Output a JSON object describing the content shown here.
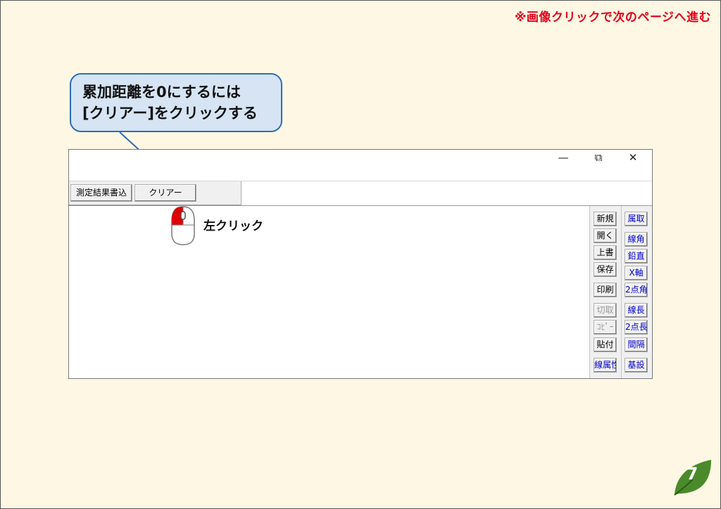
{
  "header": {
    "note": "※画像クリックで次のページへ進む"
  },
  "callout": {
    "line1": "累加距離を0にするには",
    "line2": "[クリアー]をクリックする"
  },
  "window": {
    "controls": {
      "minimize": "—",
      "restore": "⧉",
      "close": "✕"
    },
    "toolbar": {
      "measure_write": "測定結果書込",
      "clear": "クリアー"
    },
    "side_left": [
      "新規",
      "開く",
      "上書",
      "保存",
      "印刷",
      "切取",
      "ｺﾋﾟｰ",
      "貼付",
      "線属性"
    ],
    "side_right": [
      "属取",
      "線角",
      "鉛直",
      "X軸",
      "2点角",
      "線長",
      "2点長",
      "間隔",
      "基設"
    ]
  },
  "mouse": {
    "label": "左クリック"
  },
  "page": {
    "number": "7"
  },
  "colors": {
    "note_red": "#e3001b",
    "callout_border": "#2f6eb3",
    "badge_green": "#4a8a2a"
  }
}
